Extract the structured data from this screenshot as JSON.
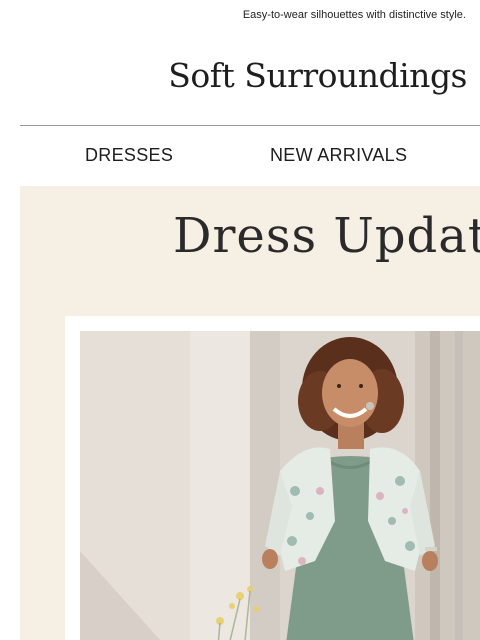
{
  "preheader": "Easy-to-wear silhouettes with distinctive style.",
  "brand": "Soft Surroundings",
  "nav": {
    "items": [
      {
        "label": "DRESSES"
      },
      {
        "label": "NEW ARRIVALS"
      }
    ]
  },
  "hero": {
    "title": "Dress Update",
    "image_icon": "woman-in-floral-cardigan-photo"
  },
  "colors": {
    "hero_background": "#f6efe4",
    "dress": "#7f9c8a",
    "text": "#222222"
  }
}
